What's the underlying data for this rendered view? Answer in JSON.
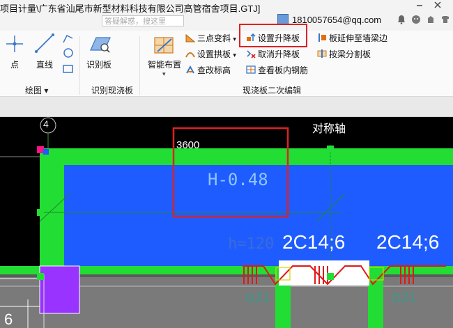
{
  "titlebar": {
    "title": "项目计量\\广东省汕尾市新型材料科技有限公司高管宿舍项目.GTJ]",
    "search_placeholder": "答疑解惑，搜这里",
    "account": "1810057654@qq.com",
    "icons": [
      "notification-icon",
      "user-center-icon",
      "help-icon",
      "skin-icon",
      "minimize-icon",
      "close-icon"
    ]
  },
  "ribbon": {
    "draw_group": {
      "label": "绘图",
      "items": [
        {
          "label": "点",
          "icon": "point-icon"
        },
        {
          "label": "直线",
          "icon": "line-icon"
        }
      ]
    },
    "recognize_group": {
      "label": "识别现浇板",
      "items": [
        {
          "label": "识别板",
          "icon": "recognize-slab-icon"
        }
      ]
    },
    "edit_group": {
      "label": "现浇板二次编辑",
      "items": [
        {
          "label": "智能布置",
          "icon": "smart-layout-icon"
        },
        {
          "label": "三点变斜",
          "icon": "three-point-slope-icon"
        },
        {
          "label": "设置拱板",
          "icon": "set-arch-slab-icon"
        },
        {
          "label": "查改标高",
          "icon": "check-elevation-icon"
        },
        {
          "label": "设置升降板",
          "icon": "set-lift-slab-icon"
        },
        {
          "label": "取消升降板",
          "icon": "cancel-lift-slab-icon"
        },
        {
          "label": "查看板内钢筋",
          "icon": "view-slab-rebar-icon"
        },
        {
          "label": "板延伸至墙梁边",
          "icon": "extend-slab-icon"
        },
        {
          "label": "按梁分割板",
          "icon": "split-slab-icon"
        }
      ]
    }
  },
  "canvas": {
    "axis_number": "4",
    "symmetry_label": "对称轴",
    "dimension": "3600",
    "slab_elevation": "H-0.48",
    "slab_thickness": "h=120",
    "rebar_left": "2C14;6",
    "rebar_right": "2C14;6",
    "column_left": "GZ1",
    "column_right": "GZ1",
    "edge_number": "6"
  },
  "colors": {
    "slab_fill": "#1f5cff",
    "beam_green": "#22dd33",
    "highlight_red": "#e02020",
    "column_purple": "#9933ff",
    "rebar_red": "#e01818"
  }
}
